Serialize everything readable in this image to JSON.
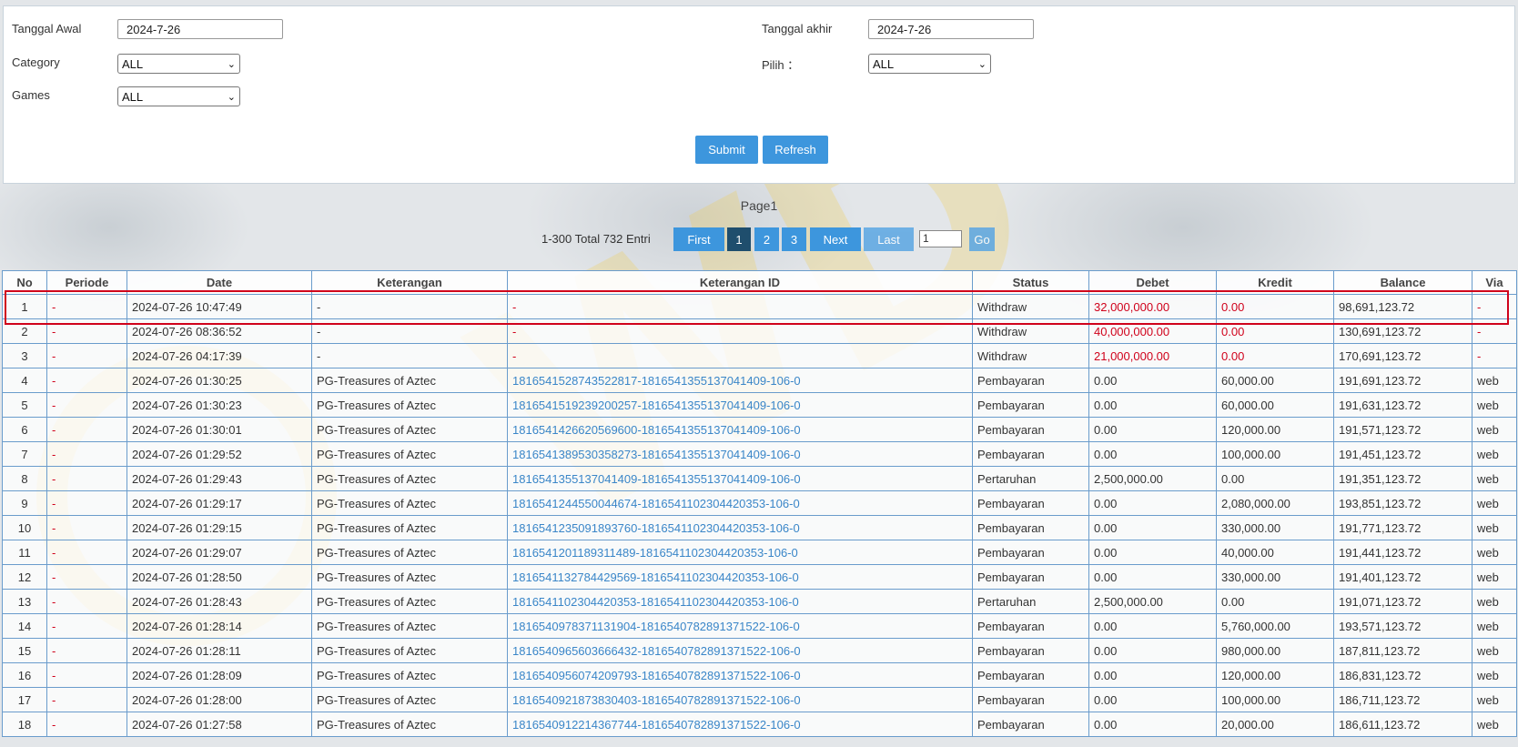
{
  "filters": {
    "tanggal_awal_label": "Tanggal Awal",
    "tanggal_awal_value": "2024-7-26",
    "tanggal_akhir_label": "Tanggal akhir",
    "tanggal_akhir_value": "2024-7-26",
    "category_label": "Category",
    "category_value": "ALL",
    "pilih_label": "Pilih ：",
    "pilih_value": "ALL",
    "games_label": "Games",
    "games_value": "ALL",
    "submit_label": "Submit",
    "refresh_label": "Refresh"
  },
  "pager": {
    "title": "Page1",
    "info": "1-300 Total 732 Entri",
    "first": "First",
    "pages": [
      "1",
      "2",
      "3"
    ],
    "next": "Next",
    "last": "Last",
    "page_input": "1",
    "go": "Go"
  },
  "table": {
    "headers": [
      "No",
      "Periode",
      "Date",
      "Keterangan",
      "Keterangan ID",
      "Status",
      "Debet",
      "Kredit",
      "Balance",
      "Via"
    ],
    "rows": [
      [
        "1",
        "-",
        "2024-07-26 10:47:49",
        "-",
        "-",
        "Withdraw",
        "32,000,000.00",
        "0.00",
        "98,691,123.72",
        "-"
      ],
      [
        "2",
        "-",
        "2024-07-26 08:36:52",
        "-",
        "-",
        "Withdraw",
        "40,000,000.00",
        "0.00",
        "130,691,123.72",
        "-"
      ],
      [
        "3",
        "-",
        "2024-07-26 04:17:39",
        "-",
        "-",
        "Withdraw",
        "21,000,000.00",
        "0.00",
        "170,691,123.72",
        "-"
      ],
      [
        "4",
        "-",
        "2024-07-26 01:30:25",
        "PG-Treasures of Aztec",
        "1816541528743522817-1816541355137041409-106-0",
        "Pembayaran",
        "0.00",
        "60,000.00",
        "191,691,123.72",
        "web"
      ],
      [
        "5",
        "-",
        "2024-07-26 01:30:23",
        "PG-Treasures of Aztec",
        "1816541519239200257-1816541355137041409-106-0",
        "Pembayaran",
        "0.00",
        "60,000.00",
        "191,631,123.72",
        "web"
      ],
      [
        "6",
        "-",
        "2024-07-26 01:30:01",
        "PG-Treasures of Aztec",
        "1816541426620569600-1816541355137041409-106-0",
        "Pembayaran",
        "0.00",
        "120,000.00",
        "191,571,123.72",
        "web"
      ],
      [
        "7",
        "-",
        "2024-07-26 01:29:52",
        "PG-Treasures of Aztec",
        "1816541389530358273-1816541355137041409-106-0",
        "Pembayaran",
        "0.00",
        "100,000.00",
        "191,451,123.72",
        "web"
      ],
      [
        "8",
        "-",
        "2024-07-26 01:29:43",
        "PG-Treasures of Aztec",
        "1816541355137041409-1816541355137041409-106-0",
        "Pertaruhan",
        "2,500,000.00",
        "0.00",
        "191,351,123.72",
        "web"
      ],
      [
        "9",
        "-",
        "2024-07-26 01:29:17",
        "PG-Treasures of Aztec",
        "1816541244550044674-1816541102304420353-106-0",
        "Pembayaran",
        "0.00",
        "2,080,000.00",
        "193,851,123.72",
        "web"
      ],
      [
        "10",
        "-",
        "2024-07-26 01:29:15",
        "PG-Treasures of Aztec",
        "1816541235091893760-1816541102304420353-106-0",
        "Pembayaran",
        "0.00",
        "330,000.00",
        "191,771,123.72",
        "web"
      ],
      [
        "11",
        "-",
        "2024-07-26 01:29:07",
        "PG-Treasures of Aztec",
        "1816541201189311489-1816541102304420353-106-0",
        "Pembayaran",
        "0.00",
        "40,000.00",
        "191,441,123.72",
        "web"
      ],
      [
        "12",
        "-",
        "2024-07-26 01:28:50",
        "PG-Treasures of Aztec",
        "1816541132784429569-1816541102304420353-106-0",
        "Pembayaran",
        "0.00",
        "330,000.00",
        "191,401,123.72",
        "web"
      ],
      [
        "13",
        "-",
        "2024-07-26 01:28:43",
        "PG-Treasures of Aztec",
        "1816541102304420353-1816541102304420353-106-0",
        "Pertaruhan",
        "2,500,000.00",
        "0.00",
        "191,071,123.72",
        "web"
      ],
      [
        "14",
        "-",
        "2024-07-26 01:28:14",
        "PG-Treasures of Aztec",
        "1816540978371131904-1816540782891371522-106-0",
        "Pembayaran",
        "0.00",
        "5,760,000.00",
        "193,571,123.72",
        "web"
      ],
      [
        "15",
        "-",
        "2024-07-26 01:28:11",
        "PG-Treasures of Aztec",
        "1816540965603666432-1816540782891371522-106-0",
        "Pembayaran",
        "0.00",
        "980,000.00",
        "187,811,123.72",
        "web"
      ],
      [
        "16",
        "-",
        "2024-07-26 01:28:09",
        "PG-Treasures of Aztec",
        "1816540956074209793-1816540782891371522-106-0",
        "Pembayaran",
        "0.00",
        "120,000.00",
        "186,831,123.72",
        "web"
      ],
      [
        "17",
        "-",
        "2024-07-26 01:28:00",
        "PG-Treasures of Aztec",
        "1816540921873830403-1816540782891371522-106-0",
        "Pembayaran",
        "0.00",
        "100,000.00",
        "186,711,123.72",
        "web"
      ],
      [
        "18",
        "-",
        "2024-07-26 01:27:58",
        "PG-Treasures of Aztec",
        "1816540912214367744-1816540782891371522-106-0",
        "Pembayaran",
        "0.00",
        "20,000.00",
        "186,611,123.72",
        "web"
      ]
    ]
  },
  "colors": {
    "button_blue": "#3d96dd",
    "active_page": "#1f4e6d",
    "debit_red": "#d0021b",
    "link_blue": "#3a86c8",
    "highlight_box": "#d0021b"
  }
}
